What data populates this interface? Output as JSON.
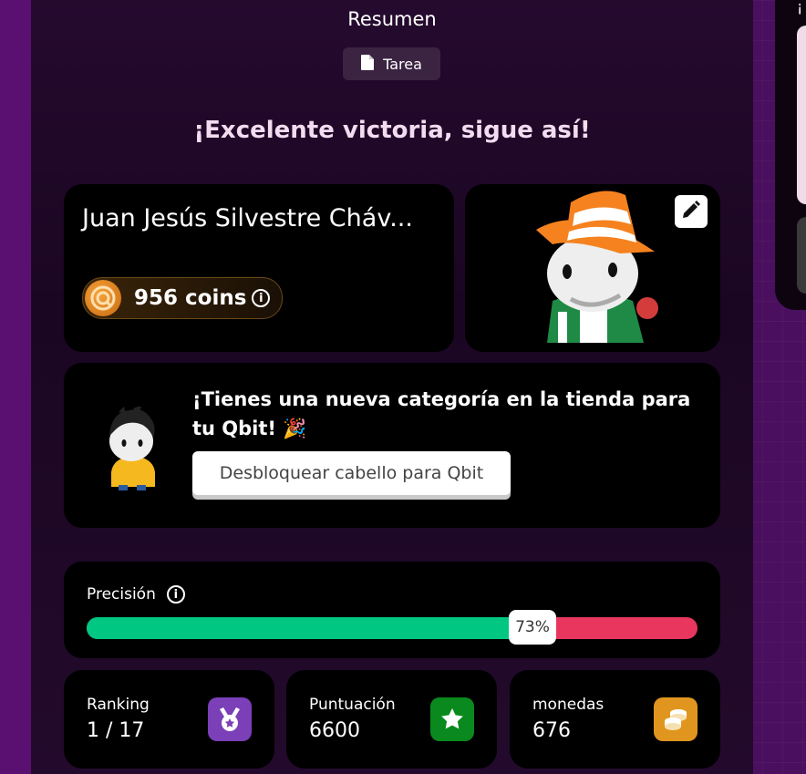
{
  "header": {
    "title": "Resumen",
    "tag_label": "Tarea",
    "tag_icon": "document-icon"
  },
  "headline": "¡Excelente victoria, sigue así!",
  "player": {
    "name": "Juan Jesús Silvestre Cháv...",
    "coins_label": "956 coins",
    "coin_icon": "coin-icon",
    "info_icon": "info-icon"
  },
  "avatar": {
    "edit_icon": "pencil-icon"
  },
  "promo": {
    "message": "¡Tienes una nueva categoría en la tienda para tu Qbit! 🎉",
    "button_label": "Desbloquear cabello para Qbit"
  },
  "accuracy": {
    "label": "Precisión",
    "value_label": "73%",
    "value": 0.73,
    "correct_color": "#00c882",
    "incorrect_color": "#e8365f"
  },
  "stats": [
    {
      "label": "Ranking",
      "value": "1 / 17",
      "icon": "medal-icon",
      "color": "#7b3fb8"
    },
    {
      "label": "Puntuación",
      "value": "6600",
      "icon": "star-icon",
      "color": "#0a8a1e"
    },
    {
      "label": "monedas",
      "value": "676",
      "icon": "coins-stack-icon",
      "color": "#e0961e"
    }
  ],
  "side": {
    "fragment": "¡"
  }
}
